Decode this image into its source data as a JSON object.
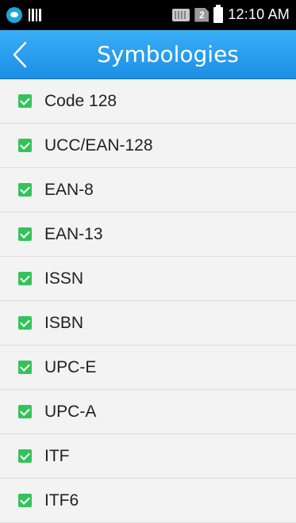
{
  "status_bar": {
    "time": "12:10 AM"
  },
  "app_bar": {
    "title": "Symbologies"
  },
  "symbologies": [
    {
      "label": "Code 128",
      "checked": true
    },
    {
      "label": "UCC/EAN-128",
      "checked": true
    },
    {
      "label": "EAN-8",
      "checked": true
    },
    {
      "label": "EAN-13",
      "checked": true
    },
    {
      "label": "ISSN",
      "checked": true
    },
    {
      "label": "ISBN",
      "checked": true
    },
    {
      "label": "UPC-E",
      "checked": true
    },
    {
      "label": "UPC-A",
      "checked": true
    },
    {
      "label": "ITF",
      "checked": true
    },
    {
      "label": "ITF6",
      "checked": true
    }
  ],
  "colors": {
    "app_bar": "#2a9ff0",
    "checkbox": "#34c35a",
    "status_bar": "#000000"
  }
}
